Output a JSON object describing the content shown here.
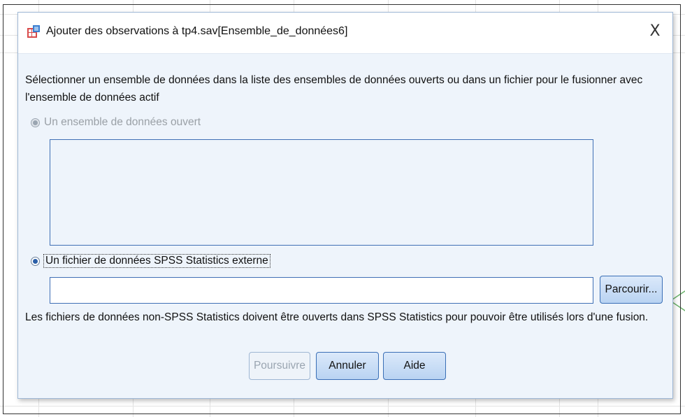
{
  "window": {
    "title": "Ajouter des observations à tp4.sav[Ensemble_de_données6]",
    "close_label": "X",
    "icon": "spss-data-icon"
  },
  "instructions": {
    "line1": "Sélectionner un ensemble de données dans la liste des ensembles de données ouverts ou dans un fichier pour le fusionner avec",
    "line2": "l'ensemble de données actif"
  },
  "options": {
    "open_dataset": {
      "label": "Un ensemble de données ouvert",
      "selected": false,
      "enabled": false
    },
    "external_file": {
      "label": "Un fichier de données SPSS Statistics externe",
      "selected": true,
      "enabled": true
    }
  },
  "file_path": {
    "value": "",
    "placeholder": ""
  },
  "browse_button": "Parcourir...",
  "note": "Les fichiers de données non-SPSS Statistics doivent être ouverts dans SPSS Statistics pour pouvoir être utilisés lors d'une fusion.",
  "footer": {
    "continue": "Poursuivre",
    "cancel": "Annuler",
    "help": "Aide"
  },
  "colors": {
    "dialog_bg": "#eef4fb",
    "button_border": "#3a6fb6",
    "accent": "#2b5fa8"
  }
}
